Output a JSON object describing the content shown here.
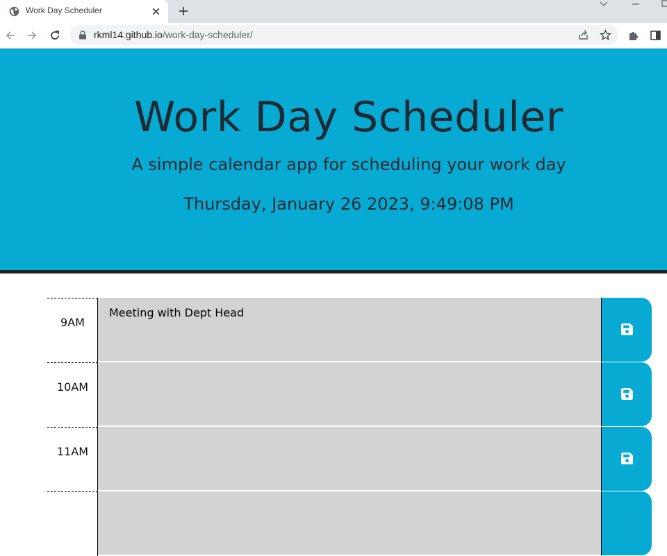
{
  "browser": {
    "tab_title": "Work Day Scheduler",
    "url_host": "rkml14.github.io",
    "url_path": "/work-day-scheduler/",
    "icons": [
      "globe-icon",
      "close-icon",
      "plus-icon",
      "back-arrow-icon",
      "forward-arrow-icon",
      "reload-icon",
      "lock-icon",
      "share-icon",
      "star-icon",
      "puzzle-icon",
      "side-panel-icon"
    ]
  },
  "header": {
    "title": "Work Day Scheduler",
    "lead": "A simple calendar app for scheduling your work day",
    "current_day": "Thursday, January 26 2023, 9:49:08 PM"
  },
  "timeblocks": [
    {
      "hour": "9AM",
      "text": "Meeting with Dept Head"
    },
    {
      "hour": "10AM",
      "text": ""
    },
    {
      "hour": "11AM",
      "text": ""
    },
    {
      "hour": "",
      "text": ""
    }
  ],
  "colors": {
    "accent": "#06aad2",
    "past": "#d3d3d3",
    "header_border": "#1f2329"
  }
}
